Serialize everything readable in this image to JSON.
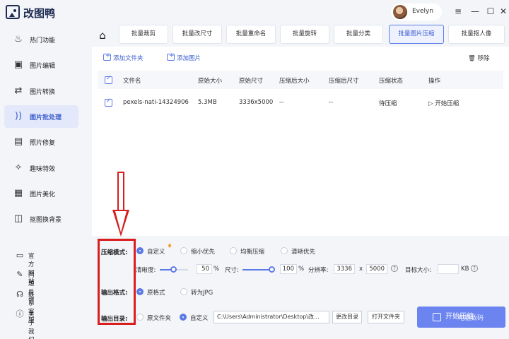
{
  "app": {
    "title": "改图鸭"
  },
  "user": {
    "name": "Evelyn"
  },
  "sidebar": {
    "items": [
      {
        "label": "热门功能",
        "icon": "fire-icon",
        "glyph": "♨"
      },
      {
        "label": "图片编辑",
        "icon": "image-edit-icon",
        "glyph": "▣"
      },
      {
        "label": "图片转换",
        "icon": "convert-icon",
        "glyph": "⇄"
      },
      {
        "label": "图片批处理",
        "icon": "batch-icon",
        "glyph": "))"
      },
      {
        "label": "照片修复",
        "icon": "photo-repair-icon",
        "glyph": "▤"
      },
      {
        "label": "趣味特效",
        "icon": "magic-icon",
        "glyph": "✧"
      },
      {
        "label": "图片美化",
        "icon": "beautify-icon",
        "glyph": "▦"
      },
      {
        "label": "抠图换背景",
        "icon": "cutout-icon",
        "glyph": "◫"
      }
    ],
    "links": [
      {
        "label": "官方网站",
        "icon": "monitor-icon",
        "glyph": "▭"
      },
      {
        "label": "问题反馈",
        "icon": "feedback-icon",
        "glyph": "✎"
      },
      {
        "label": "联系客服",
        "icon": "service-icon",
        "glyph": "☊"
      },
      {
        "label": "关于我们",
        "icon": "info-icon",
        "glyph": "ⓘ"
      }
    ]
  },
  "tabs": [
    "批量裁剪",
    "批量改尺寸",
    "批量重命名",
    "批量旋转",
    "批量分类",
    "批量图片压缩",
    "批量抠人像"
  ],
  "toolbar": {
    "add_folder": "添加文件夹",
    "add_image": "添加图片",
    "remove": "移除"
  },
  "table": {
    "headers": [
      "文件名",
      "原始大小",
      "原始尺寸",
      "压缩后大小",
      "压缩后尺寸",
      "压缩状态",
      "操作"
    ],
    "rows": [
      {
        "name": "pexels-nati-14324906",
        "size": "5.3MB",
        "dims": "3336x5000",
        "new_size": "--",
        "new_dims": "--",
        "status": "待压缩",
        "action": "开始压缩"
      }
    ]
  },
  "settings": {
    "mode_label": "压缩模式:",
    "mode_options": [
      "自定义",
      "缩小优先",
      "均衡压缩",
      "清晰优先"
    ],
    "clarity_label": "清晰度:",
    "clarity_value": "50",
    "clarity_fraction": 0.5,
    "size_label": "尺寸:",
    "size_value": "100",
    "size_fraction": 1.0,
    "percent": "%",
    "resolution_label": "分辨率:",
    "res_w": "3336",
    "res_x": "x",
    "res_h": "5000",
    "target_label": "目标大小:",
    "target_unit": "KB",
    "format_label": "输出格式:",
    "format_options": [
      "原格式",
      "转为JPG"
    ],
    "dir_label": "输出目录:",
    "dir_options": [
      "原文件夹",
      "自定义"
    ],
    "dir_path": "C:\\Users\\Administrator\\Desktop\\改...",
    "change_dir": "更改目录",
    "open_dir": "打开文件夹",
    "start": "开始压缩"
  },
  "watermark": "电脑数码"
}
